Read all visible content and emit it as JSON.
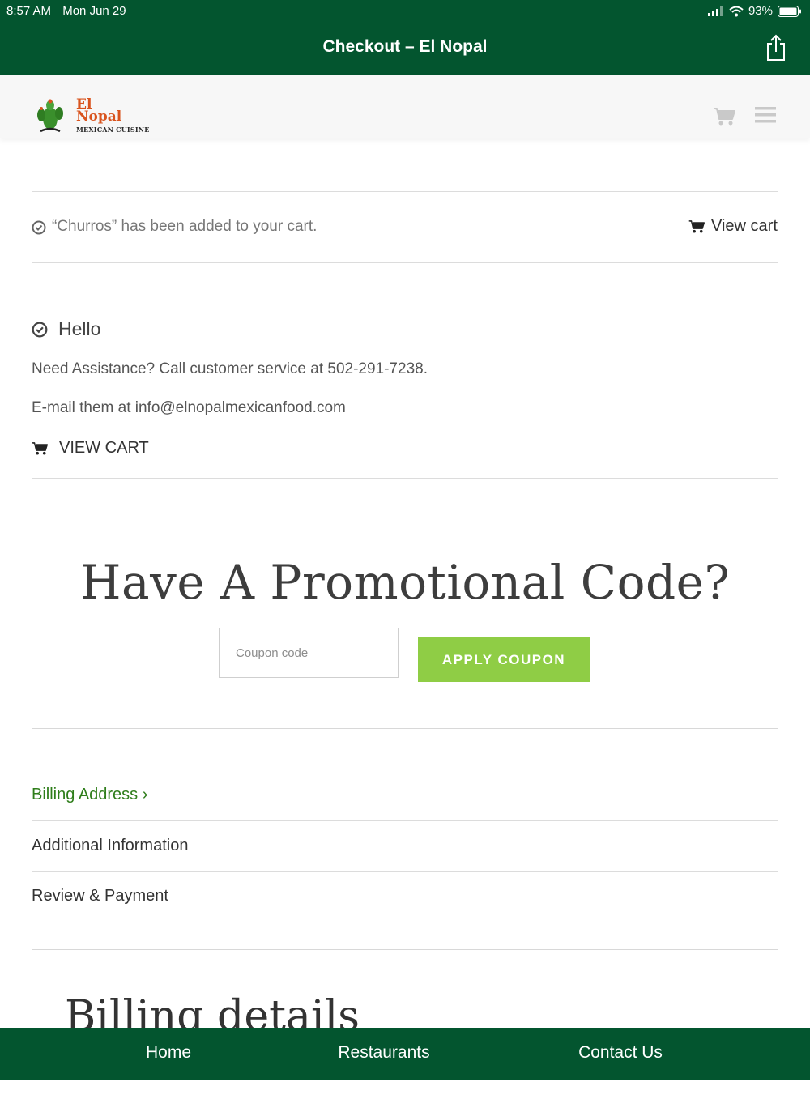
{
  "status_bar": {
    "time": "8:57 AM",
    "date": "Mon Jun 29",
    "battery": "93%"
  },
  "nav": {
    "title": "Checkout – El Nopal"
  },
  "logo": {
    "line1": "El",
    "line2": "Nopal",
    "line3": "MEXICAN CUISINE"
  },
  "notice": {
    "message": "“Churros” has been added to your cart.",
    "view_cart": "View cart"
  },
  "info": {
    "heading": "Hello",
    "assistance": "Need Assistance? Call customer service at 502-291-7238.",
    "email": "E-mail them at info@elnopalmexicanfood.com",
    "view_cart": "VIEW CART"
  },
  "promo": {
    "title": "Have A Promotional Code?",
    "placeholder": "Coupon code",
    "button": "APPLY COUPON"
  },
  "steps": [
    {
      "label": "Billing Address ›",
      "active": true
    },
    {
      "label": "Additional Information",
      "active": false
    },
    {
      "label": "Review & Payment",
      "active": false
    }
  ],
  "billing": {
    "title": "Billing details"
  },
  "tabs": [
    {
      "label": "Home"
    },
    {
      "label": "Restaurants"
    },
    {
      "label": "Contact Us"
    }
  ],
  "colors": {
    "brand_green": "#03552f",
    "accent_green": "#8fcd45",
    "link_green": "#2e7d1a",
    "logo_orange": "#d9541e"
  }
}
